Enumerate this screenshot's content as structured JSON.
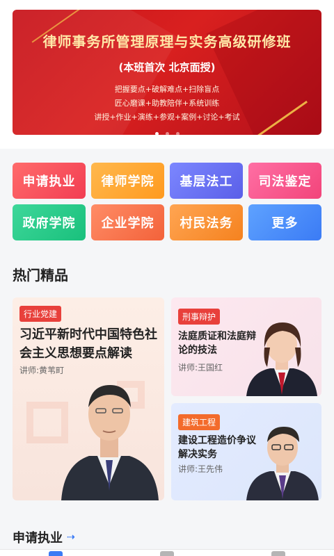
{
  "banner": {
    "title": "律师事务所管理原理与实务高级研修班",
    "subtitle": "(本班首次 北京面授)",
    "lines": [
      "把握要点+破解难点+扫除盲点",
      "匠心磨课+助教陪伴+系统训练",
      "讲授+作业+演练+参观+案例+讨论+考试"
    ],
    "dots_total": 3,
    "dots_active_index": 0
  },
  "categories": [
    {
      "label": "申请执业",
      "color": "#f23d52"
    },
    {
      "label": "律师学院",
      "color": "#ff9a1f"
    },
    {
      "label": "基层法工",
      "color": "#5a5fe8"
    },
    {
      "label": "司法鉴定",
      "color": "#f2447a"
    },
    {
      "label": "政府学院",
      "color": "#19c07c"
    },
    {
      "label": "企业学院",
      "color": "#f3623a"
    },
    {
      "label": "村民法务",
      "color": "#f5821f"
    },
    {
      "label": "更多",
      "color": "#3b7bf5"
    }
  ],
  "hot": {
    "title": "热门精品",
    "cards": [
      {
        "tag": "行业党建",
        "title": "习近平新时代中国特色社会主义思想要点解读",
        "lecturer": "讲师:黄苇町"
      },
      {
        "tag": "刑事辩护",
        "title": "法庭质证和法庭辩论的技法",
        "lecturer": "讲师:王国红"
      },
      {
        "tag": "建筑工程",
        "title": "建设工程造价争议解决实务",
        "lecturer": "讲师:王先伟"
      }
    ]
  },
  "section2": {
    "title": "申请执业",
    "icon": "arrow-right-icon"
  }
}
